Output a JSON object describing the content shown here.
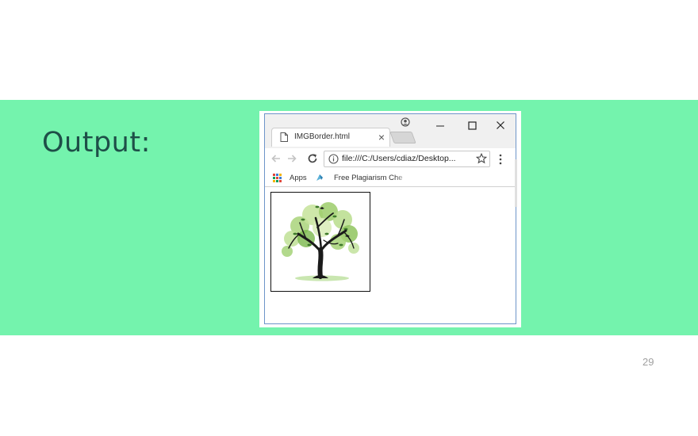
{
  "slide": {
    "heading": "Output:",
    "page_number": "29",
    "band_color": "#74f3ad"
  },
  "browser": {
    "tab": {
      "title": "IMGBorder.html",
      "icon": "page-icon",
      "close_icon": "close-icon"
    },
    "window_controls": [
      "profile-icon",
      "minimize-icon",
      "maximize-icon",
      "close-icon"
    ],
    "toolbar": {
      "back_icon": "arrow-left-icon",
      "forward_icon": "arrow-right-icon",
      "reload_icon": "reload-icon",
      "url": "file:///C:/Users/cdiaz/Desktop...",
      "info_icon": "info-icon",
      "bookmark_icon": "star-icon",
      "menu_icon": "vertical-dots-icon"
    },
    "bookmarks": [
      {
        "label": "Apps",
        "icon": "apps-grid-icon"
      },
      {
        "label": "Free Plagiarism Che",
        "icon": "site-favicon"
      }
    ],
    "content": {
      "image": "tree-icon",
      "border_color": "#111111"
    }
  }
}
